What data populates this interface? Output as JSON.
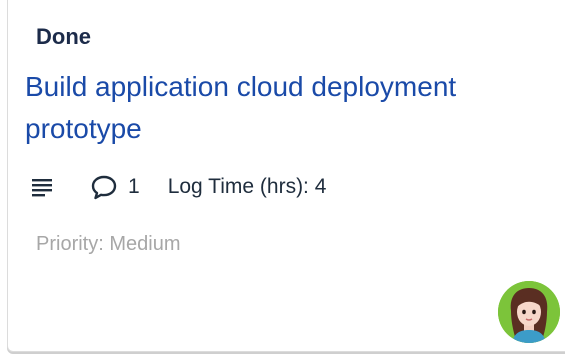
{
  "card": {
    "status": "Done",
    "title": "Build application cloud deployment prototype",
    "comment_count": "1",
    "log_time": "Log Time (hrs): 4",
    "priority": "Priority: Medium"
  },
  "icons": {
    "description": "description-lines-icon",
    "comments": "comment-bubble-icon",
    "assignee": "user-avatar"
  },
  "colors": {
    "status_text": "#1c2b4a",
    "title_link": "#1a4aa8",
    "priority_text": "#a7a7a7",
    "avatar_bg": "#7cc43a"
  }
}
